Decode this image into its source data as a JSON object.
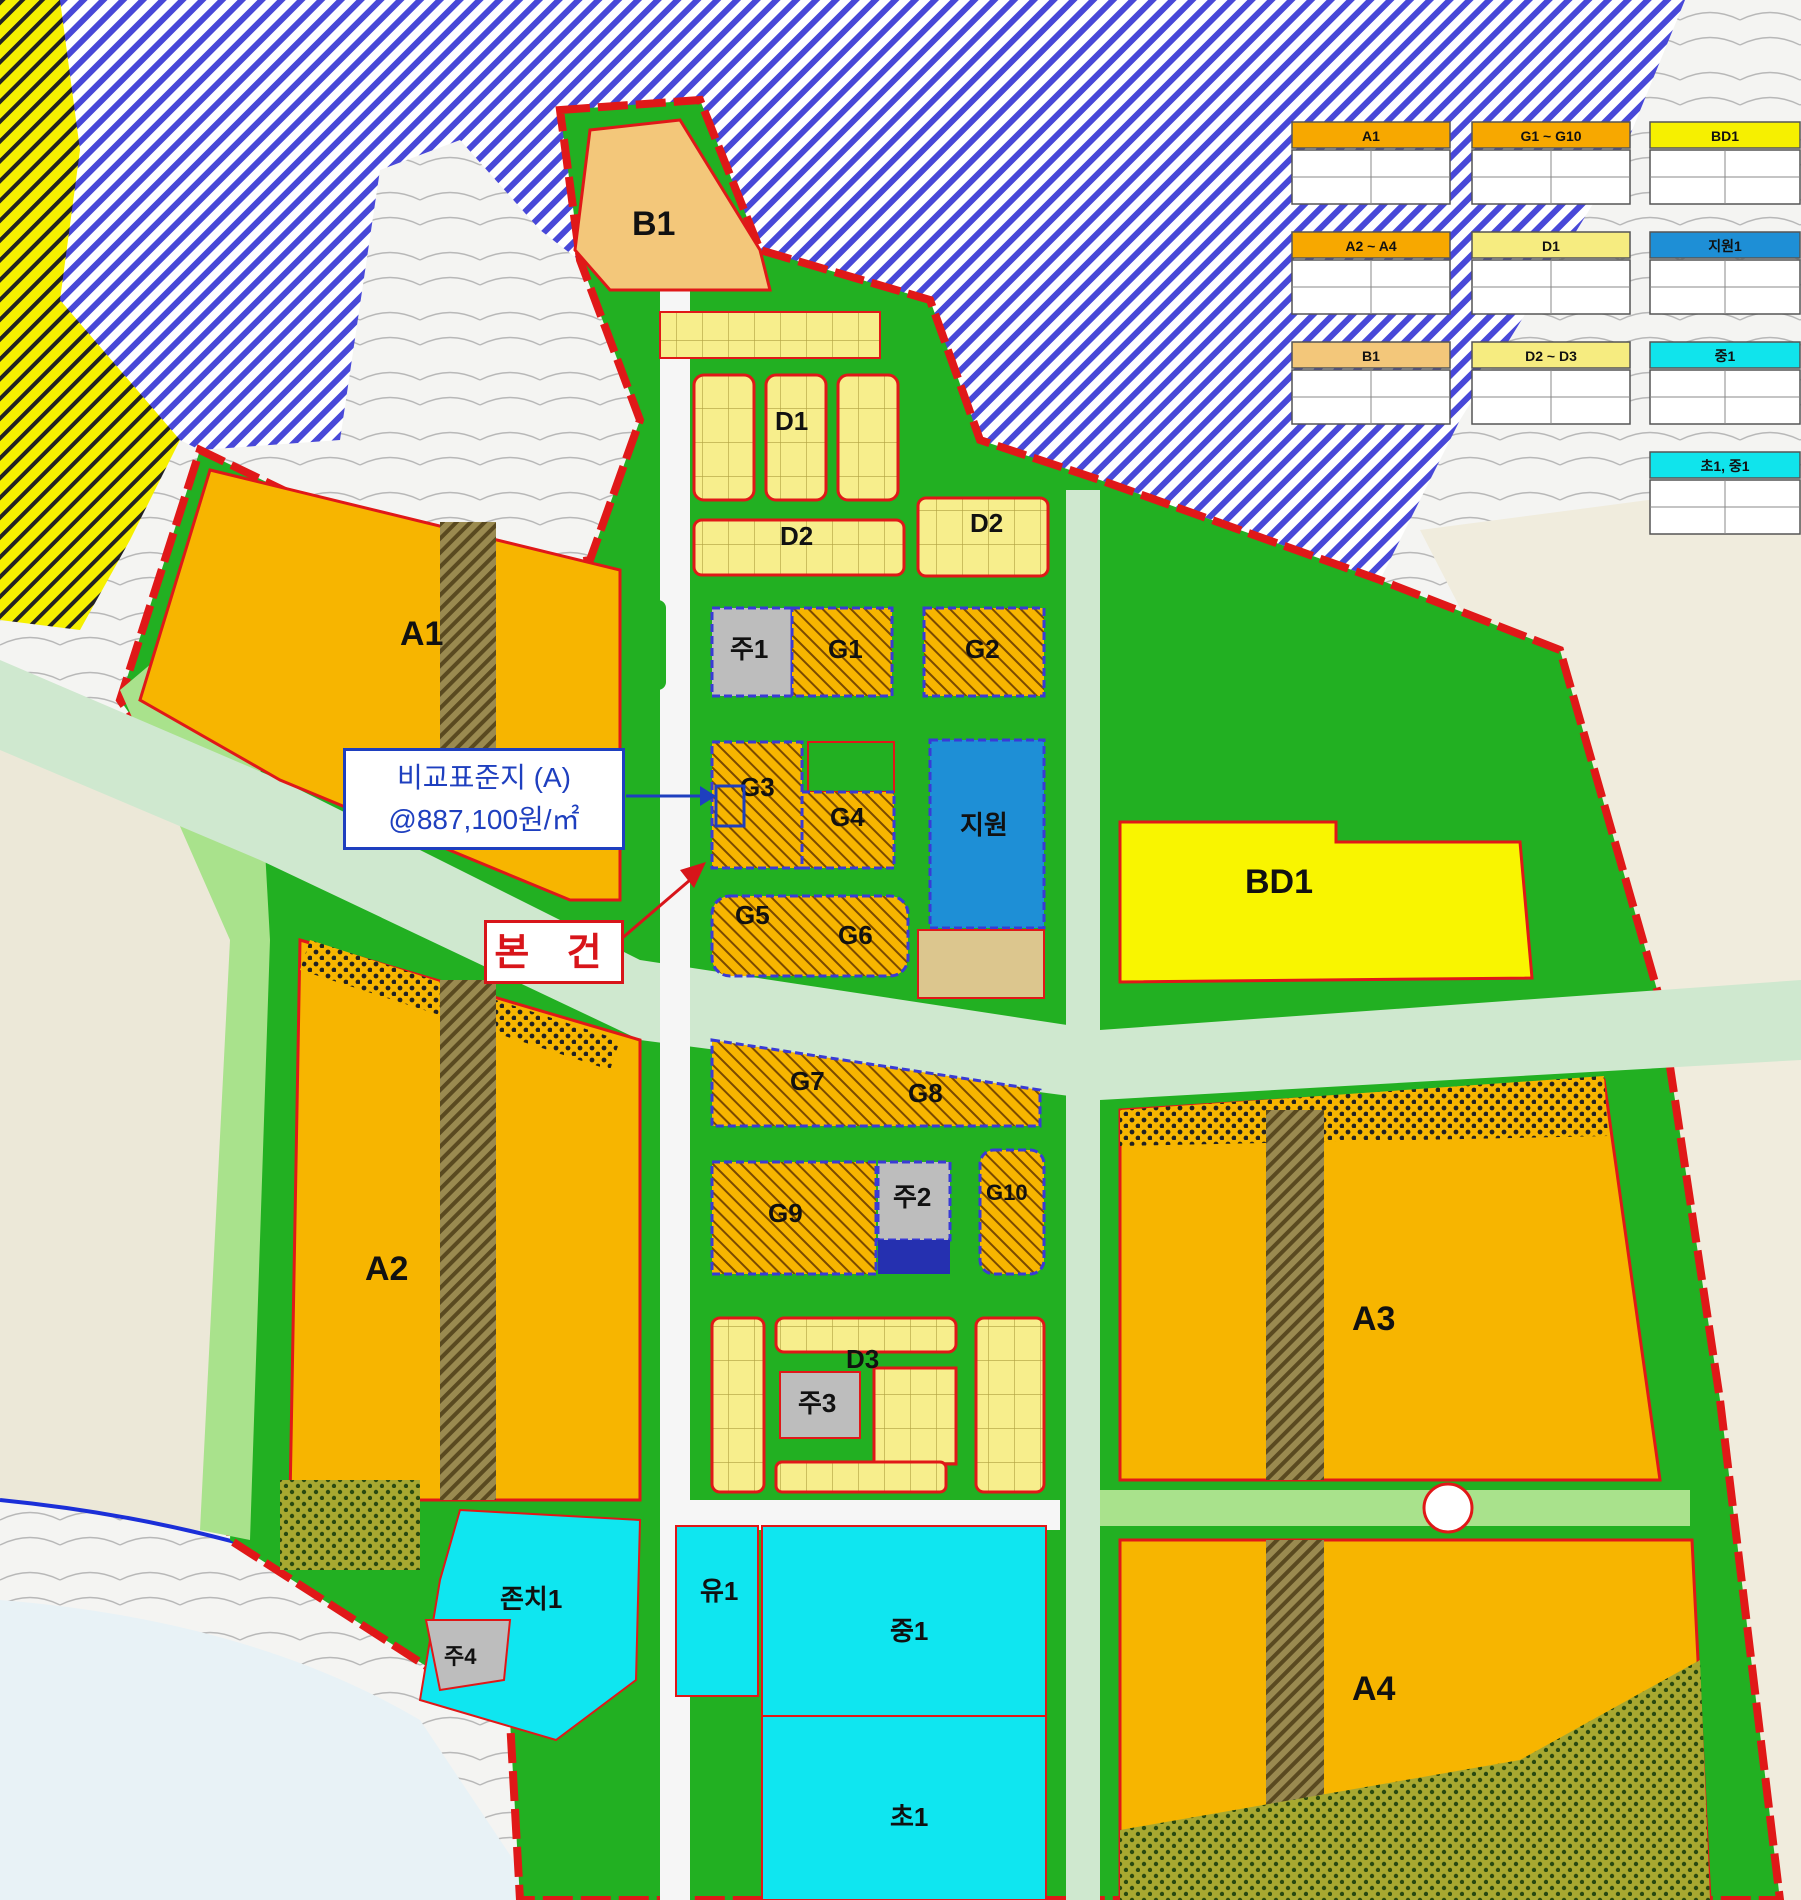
{
  "map": {
    "blocks": {
      "B1": "B1",
      "D1": "D1",
      "D2_left": "D2",
      "D2_right": "D2",
      "A1": "A1",
      "A2": "A2",
      "A3": "A3",
      "A4": "A4",
      "BD1": "BD1",
      "ju1": "주1",
      "ju2": "주2",
      "ju3": "주3",
      "ju4": "주4",
      "G1": "G1",
      "G2": "G2",
      "G3": "G3",
      "G4": "G4",
      "G5": "G5",
      "G6": "G6",
      "G7": "G7",
      "G8": "G8",
      "G9": "G9",
      "G10": "G10",
      "D3": "D3",
      "jiwon": "지원",
      "yu1": "유1",
      "jung1": "중1",
      "cho1": "초1",
      "jonchi1": "존치1"
    },
    "callout": {
      "line1": "비교표준지 (A)",
      "line2": "@887,100원/㎡"
    },
    "subject_label": "본 건",
    "legend": [
      {
        "title": "A1",
        "color": "#f7a800"
      },
      {
        "title": "G1 ~ G10",
        "color": "#f7a800"
      },
      {
        "title": "BD1",
        "color": "#f6f000"
      },
      {
        "title": "A2 ~ A4",
        "color": "#f7a800"
      },
      {
        "title": "D1",
        "color": "#f6ec80"
      },
      {
        "title": "지원1",
        "color": "#1e8fd6"
      },
      {
        "title": "B1",
        "color": "#f3c77a"
      },
      {
        "title": "D2 ~ D3",
        "color": "#f6ec80"
      },
      {
        "title": "중1",
        "color": "#10e4ec"
      },
      {
        "title": "초1, 중1",
        "color": "#10e4ec"
      }
    ],
    "colors": {
      "apartment": "#f7b500",
      "green": "#22b022",
      "light_green": "#a9e28c",
      "school": "#0fe6f0",
      "support": "#1e8fd6",
      "commercial_yellow": "#f9f500",
      "detached": "#f7ee8c",
      "boundary": "#e01818",
      "hatch_blue": "#3b3bd6"
    }
  }
}
